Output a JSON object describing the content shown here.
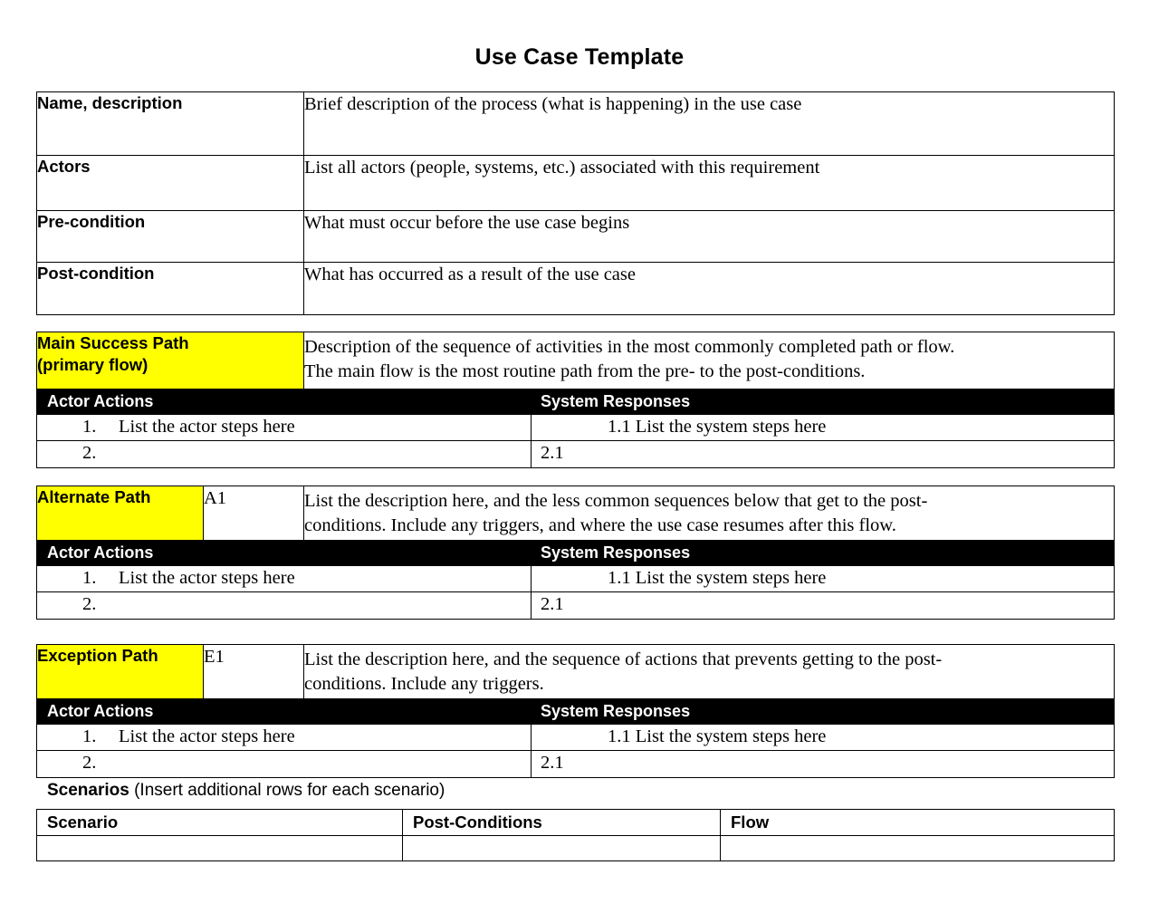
{
  "document": {
    "title": "Use Case Template"
  },
  "attributes": {
    "rows": [
      {
        "label": "Name, description",
        "value": "Brief description of the process (what is happening) in the use case"
      },
      {
        "label": "Actors",
        "value": "List all actors (people, systems, etc.) associated with this requirement"
      },
      {
        "label": "Pre-condition",
        "value": "What must occur before the use case begins"
      },
      {
        "label": "Post-condition",
        "value": "What has occurred as a result of the use case"
      }
    ]
  },
  "main_success_path": {
    "label_line1": "Main Success Path",
    "label_line2": "(primary flow)",
    "description_line1": "Description of the sequence of activities in the most commonly completed path or flow.",
    "description_line2": "The main flow is the most routine path from the pre- to the post-conditions.",
    "actor_header": "Actor Actions",
    "system_header": "System Responses",
    "steps": [
      {
        "actor_num": "1.",
        "actor_text": "List the actor steps here",
        "system_num": "1.1",
        "system_text": "List the system steps here"
      },
      {
        "actor_num": "2.",
        "actor_text": "",
        "system_num": "2.1",
        "system_text": ""
      }
    ]
  },
  "alternate_path": {
    "label": "Alternate Path",
    "id": "A1",
    "description_line1": "List the description here, and the less common sequences below that get to the post-",
    "description_line2": "conditions. Include any triggers, and where the use case resumes after this flow.",
    "actor_header": "Actor Actions",
    "system_header": "System Responses",
    "steps": [
      {
        "actor_num": "1.",
        "actor_text": "List the actor steps here",
        "system_num": "1.1",
        "system_text": "List the system steps here"
      },
      {
        "actor_num": "2.",
        "actor_text": "",
        "system_num": "2.1",
        "system_text": ""
      }
    ]
  },
  "exception_path": {
    "label": "Exception Path",
    "id": "E1",
    "description_line1": "List the description here, and the sequence of actions that prevents getting to the post-",
    "description_line2": "conditions. Include any triggers.",
    "actor_header": "Actor Actions",
    "system_header": "System Responses",
    "steps": [
      {
        "actor_num": "1.",
        "actor_text": "List the actor steps here",
        "system_num": "1.1",
        "system_text": "List the system steps here"
      },
      {
        "actor_num": "2.",
        "actor_text": "",
        "system_num": "2.1",
        "system_text": ""
      }
    ]
  },
  "scenarios": {
    "caption_bold": "Scenarios",
    "caption_rest": " (Insert additional rows for each scenario)",
    "headers": [
      "Scenario",
      "Post-Conditions",
      "Flow"
    ],
    "rows": [
      {
        "scenario": "",
        "post_conditions": "",
        "flow": ""
      }
    ]
  },
  "colors": {
    "highlight": "#FFFF00",
    "header_bg": "#000000",
    "header_text": "#FFFFFF",
    "border": "#000000",
    "page_bg": "#FFFFFF"
  }
}
